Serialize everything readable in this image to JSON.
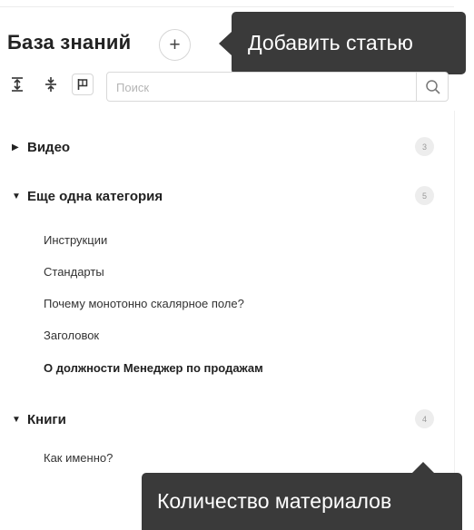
{
  "header": {
    "title": "База знаний",
    "add_symbol": "+"
  },
  "tooltips": {
    "add_article": "Добавить статью",
    "materials_count": "Количество материалов"
  },
  "toolbar": {
    "icons": [
      "expand-vertical-icon",
      "collapse-vertical-icon",
      "flag-icon"
    ]
  },
  "search": {
    "placeholder": "Поиск",
    "value": ""
  },
  "categories": [
    {
      "label": "Видео",
      "count": "3",
      "expanded": false,
      "items": []
    },
    {
      "label": "Еще одна категория",
      "count": "5",
      "expanded": true,
      "items": [
        {
          "label": "Инструкции",
          "active": false
        },
        {
          "label": "Стандарты",
          "active": false
        },
        {
          "label": "Почему монотонно скалярное поле?",
          "active": false
        },
        {
          "label": "Заголовок",
          "active": false
        },
        {
          "label": "О должности Менеджер по продажам",
          "active": true
        }
      ]
    },
    {
      "label": "Книги",
      "count": "4",
      "expanded": true,
      "items": [
        {
          "label": "Как именно?",
          "active": false
        }
      ]
    }
  ],
  "colors": {
    "tooltip_bg": "#3a3a3a",
    "badge_bg": "#ededed",
    "border": "#d9d9d9"
  }
}
